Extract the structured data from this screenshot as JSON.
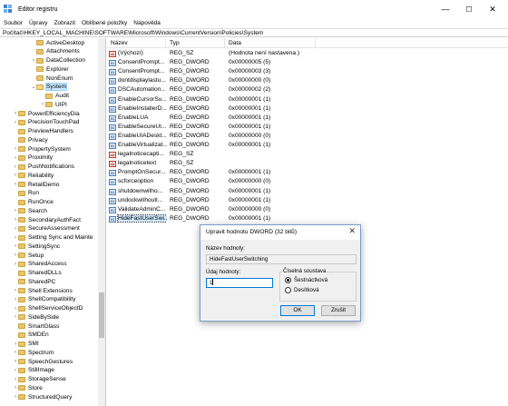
{
  "window": {
    "title": "Editor registru",
    "controls": [
      "—",
      "☐",
      "✕"
    ]
  },
  "menu": [
    "Soubor",
    "Úpravy",
    "Zobrazit",
    "Oblíbené položky",
    "Nápověda"
  ],
  "address": "Počítač\\HKEY_LOCAL_MACHINE\\SOFTWARE\\Microsoft\\Windows\\CurrentVersion\\Policies\\System",
  "tree": [
    {
      "label": "ActiveDesktop",
      "indent": 3,
      "arrow": ""
    },
    {
      "label": "Attachments",
      "indent": 3,
      "arrow": ""
    },
    {
      "label": "DataCollection",
      "indent": 3,
      "arrow": "›"
    },
    {
      "label": "Explorer",
      "indent": 3,
      "arrow": ""
    },
    {
      "label": "NonEnum",
      "indent": 3,
      "arrow": ""
    },
    {
      "label": "System",
      "indent": 3,
      "arrow": "⌄",
      "selected": true,
      "open": true
    },
    {
      "label": "Audit",
      "indent": 4,
      "arrow": ""
    },
    {
      "label": "UIPI",
      "indent": 4,
      "arrow": "›"
    },
    {
      "label": "PowerEfficiencyDia",
      "indent": 1,
      "arrow": "›"
    },
    {
      "label": "PrecisionTouchPad",
      "indent": 1,
      "arrow": "›"
    },
    {
      "label": "PreviewHandlers",
      "indent": 1,
      "arrow": ""
    },
    {
      "label": "Privacy",
      "indent": 1,
      "arrow": ""
    },
    {
      "label": "PropertySystem",
      "indent": 1,
      "arrow": "›"
    },
    {
      "label": "Proximity",
      "indent": 1,
      "arrow": "›"
    },
    {
      "label": "PushNotifications",
      "indent": 1,
      "arrow": "›"
    },
    {
      "label": "Reliability",
      "indent": 1,
      "arrow": "›"
    },
    {
      "label": "RetailDemo",
      "indent": 1,
      "arrow": "›"
    },
    {
      "label": "Run",
      "indent": 1,
      "arrow": ""
    },
    {
      "label": "RunOnce",
      "indent": 1,
      "arrow": ""
    },
    {
      "label": "Search",
      "indent": 1,
      "arrow": "›"
    },
    {
      "label": "SecondaryAuthFact",
      "indent": 1,
      "arrow": "›"
    },
    {
      "label": "SecureAssessment",
      "indent": 1,
      "arrow": "›"
    },
    {
      "label": "Setting Sync and Mainte",
      "indent": 1,
      "arrow": "›"
    },
    {
      "label": "SettingSync",
      "indent": 1,
      "arrow": "›"
    },
    {
      "label": "Setup",
      "indent": 1,
      "arrow": "›"
    },
    {
      "label": "SharedAccess",
      "indent": 1,
      "arrow": "›"
    },
    {
      "label": "SharedDLLs",
      "indent": 1,
      "arrow": ""
    },
    {
      "label": "SharedPC",
      "indent": 1,
      "arrow": ""
    },
    {
      "label": "Shell Extensions",
      "indent": 1,
      "arrow": "›"
    },
    {
      "label": "ShellCompatibility",
      "indent": 1,
      "arrow": "›"
    },
    {
      "label": "ShellServiceObjectD",
      "indent": 1,
      "arrow": "›"
    },
    {
      "label": "SideBySide",
      "indent": 1,
      "arrow": "›"
    },
    {
      "label": "SmartGlass",
      "indent": 1,
      "arrow": ""
    },
    {
      "label": "SMDEn",
      "indent": 1,
      "arrow": ""
    },
    {
      "label": "SMI",
      "indent": 1,
      "arrow": "›"
    },
    {
      "label": "Spectrum",
      "indent": 1,
      "arrow": "›"
    },
    {
      "label": "SpeechGestures",
      "indent": 1,
      "arrow": "›"
    },
    {
      "label": "StillImage",
      "indent": 1,
      "arrow": "›"
    },
    {
      "label": "StorageSense",
      "indent": 1,
      "arrow": "›"
    },
    {
      "label": "Store",
      "indent": 1,
      "arrow": "›"
    },
    {
      "label": "StructuredQuery",
      "indent": 1,
      "arrow": "›"
    }
  ],
  "list": {
    "headers": [
      "Název",
      "Typ",
      "Data"
    ],
    "rows": [
      {
        "name": "(Výchozí)",
        "type": "REG_SZ",
        "data": "(Hodnota není nastavena.)",
        "kind": "sz"
      },
      {
        "name": "ConsentPrompt...",
        "type": "REG_DWORD",
        "data": "0x00000005 (5)",
        "kind": "dw"
      },
      {
        "name": "ConsentPrompt...",
        "type": "REG_DWORD",
        "data": "0x00000003 (3)",
        "kind": "dw"
      },
      {
        "name": "dontdisplaylastu...",
        "type": "REG_DWORD",
        "data": "0x00000000 (0)",
        "kind": "dw"
      },
      {
        "name": "DSCAutomation...",
        "type": "REG_DWORD",
        "data": "0x00000002 (2)",
        "kind": "dw"
      },
      {
        "name": "EnableCursorSu...",
        "type": "REG_DWORD",
        "data": "0x00000001 (1)",
        "kind": "dw"
      },
      {
        "name": "EnableInstallerD...",
        "type": "REG_DWORD",
        "data": "0x00000001 (1)",
        "kind": "dw"
      },
      {
        "name": "EnableLUA",
        "type": "REG_DWORD",
        "data": "0x00000001 (1)",
        "kind": "dw"
      },
      {
        "name": "EnableSecureUI...",
        "type": "REG_DWORD",
        "data": "0x00000001 (1)",
        "kind": "dw"
      },
      {
        "name": "EnableUIADeskt...",
        "type": "REG_DWORD",
        "data": "0x00000000 (0)",
        "kind": "dw"
      },
      {
        "name": "EnableVirtualizat...",
        "type": "REG_DWORD",
        "data": "0x00000001 (1)",
        "kind": "dw"
      },
      {
        "name": "legalnoticecapti...",
        "type": "REG_SZ",
        "data": "",
        "kind": "sz"
      },
      {
        "name": "legalnoticetext",
        "type": "REG_SZ",
        "data": "",
        "kind": "sz"
      },
      {
        "name": "PromptOnSecur...",
        "type": "REG_DWORD",
        "data": "0x00000001 (1)",
        "kind": "dw"
      },
      {
        "name": "scforceoption",
        "type": "REG_DWORD",
        "data": "0x00000000 (0)",
        "kind": "dw"
      },
      {
        "name": "shutdownwitho...",
        "type": "REG_DWORD",
        "data": "0x00000001 (1)",
        "kind": "dw"
      },
      {
        "name": "undockwithoutl...",
        "type": "REG_DWORD",
        "data": "0x00000001 (1)",
        "kind": "dw"
      },
      {
        "name": "ValidateAdminC...",
        "type": "REG_DWORD",
        "data": "0x00000000 (0)",
        "kind": "dw"
      },
      {
        "name": "HideFastUserSwi...",
        "type": "REG_DWORD",
        "data": "0x00000001 (1)",
        "kind": "dw",
        "selected": true
      }
    ]
  },
  "dialog": {
    "title": "Upravit hodnotu DWORD (32 bitů)",
    "close": "✕",
    "name_label": "Název hodnoty:",
    "name_value": "HideFastUserSwitching",
    "data_label": "Údaj hodnoty:",
    "data_value": "1",
    "base_label": "Číselná soustava",
    "hex_label": "Šestnáctková",
    "dec_label": "Desítková",
    "ok": "OK",
    "cancel": "Zrušit"
  }
}
